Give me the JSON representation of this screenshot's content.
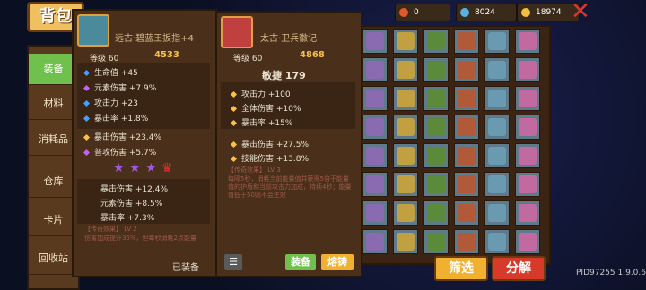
{
  "header": {
    "title": "背包"
  },
  "resources": [
    {
      "name": "gem",
      "value": "0",
      "color": "#e05a2a"
    },
    {
      "name": "blue-coin",
      "value": "8024",
      "color": "#5ab0e0"
    },
    {
      "name": "gold-coin",
      "value": "18974",
      "color": "#f0c040"
    }
  ],
  "sidebar": {
    "items": [
      {
        "label": "装备",
        "active": true
      },
      {
        "label": "材料"
      },
      {
        "label": "消耗品"
      },
      {
        "label": "仓库"
      },
      {
        "label": "卡片"
      },
      {
        "label": "回收站"
      }
    ]
  },
  "item1": {
    "name": "远古·碧蓝王扳指+4",
    "level_label": "等级",
    "level": "60",
    "power": "4533",
    "stats": [
      {
        "text": "生命值 +45",
        "color": "#42a0ff"
      },
      {
        "text": "元素伤害 +7.9%",
        "color": "#c060ff"
      },
      {
        "text": "攻击力 +23",
        "color": "#42a0ff"
      },
      {
        "text": "暴击率 +1.8%",
        "color": "#42a0ff"
      }
    ],
    "stats2": [
      {
        "text": "暴击伤害 +23.4%"
      },
      {
        "text": "普攻伤害 +5.7%"
      }
    ],
    "stats3": [
      {
        "text": "暴击伤害 +12.4%"
      },
      {
        "text": "元素伤害 +8.5%"
      },
      {
        "text": "暴击率 +7.3%"
      }
    ],
    "legend_title": "【传奇效果】 LV 2",
    "legend_text": "伤害加成提升35%，但每秒消耗2点能量",
    "equipped": "已装备"
  },
  "item2": {
    "name": "太古·卫兵徽记",
    "level_label": "等级",
    "level": "60",
    "power": "4868",
    "main_stat": "敏捷 179",
    "stats": [
      {
        "text": "攻击力 +100"
      },
      {
        "text": "全体伤害 +10%"
      },
      {
        "text": "暴击率 +15%"
      }
    ],
    "stats2": [
      {
        "text": "暴击伤害 +27.5%"
      },
      {
        "text": "技能伤害 +13.8%"
      }
    ],
    "legend_title": "【传奇效果】 LV 3",
    "legend_text": "每隔5秒，消耗当前能量值并获得5倍于能量值的护盾和当前攻击力加成，持续4秒；能量值低于50则不会生效",
    "equip_button": "装备",
    "melt_button": "熔铸"
  },
  "bottom": {
    "filter": "筛选",
    "decompose": "分解"
  },
  "footer": {
    "pid": "PID97255 1.9.0.6"
  }
}
